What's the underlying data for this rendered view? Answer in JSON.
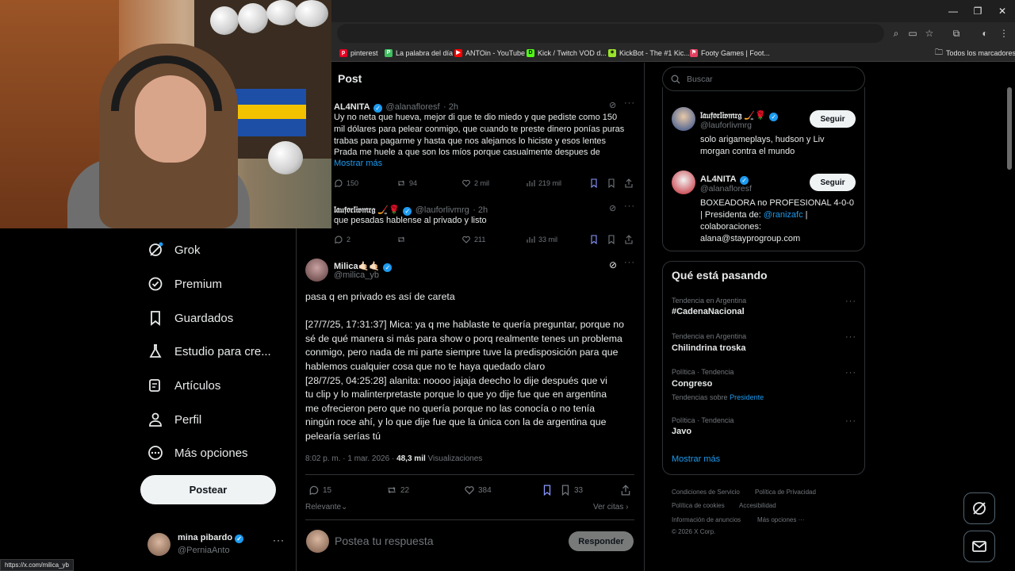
{
  "browser": {
    "bookmarks": [
      {
        "label": "pinterest",
        "color": "#e60023"
      },
      {
        "label": "La palabra del día",
        "color": "#3fbf5f"
      },
      {
        "label": "ANTOin - YouTube",
        "color": "#ff0000"
      },
      {
        "label": "Kick / Twitch VOD d...",
        "color": "#53fc18"
      },
      {
        "label": "KickBot - The #1 Kic...",
        "color": "#9be52a"
      },
      {
        "label": "Footy Games | Foot...",
        "color": "#e4405f"
      }
    ],
    "all_bookmarks": "Todos los marcadores",
    "status_url": "https://x.com/milica_yb"
  },
  "nav": {
    "items": [
      {
        "label": "Grok",
        "icon": "grok-icon"
      },
      {
        "label": "Premium",
        "icon": "premium-icon"
      },
      {
        "label": "Guardados",
        "icon": "bookmark-icon"
      },
      {
        "label": "Estudio para cre...",
        "icon": "studio-icon"
      },
      {
        "label": "Artículos",
        "icon": "articles-icon"
      },
      {
        "label": "Perfil",
        "icon": "profile-icon"
      },
      {
        "label": "Más opciones",
        "icon": "more-icon"
      }
    ],
    "post_button": "Postear",
    "account": {
      "name": "mina pibardo",
      "handle": "@PerniaAnto"
    }
  },
  "header": {
    "title": "Post"
  },
  "context_tweets": [
    {
      "name": "AL4NITA",
      "handle": "@alanafloresf",
      "time": "· 2h",
      "text": "Uy no neta que hueva, mejor di que te dio miedo y que pediste como 150\nmil dólares para pelear conmigo, que cuando te preste dinero ponías puras\ntrabas para pagarme y hasta que nos alejamos lo hiciste y esos lentes\nPrada me huele a que son los míos porque casualmente despues de",
      "show_more": "Mostrar más",
      "replies": "150",
      "reposts": "94",
      "likes": "2 mil",
      "views": "219 mil"
    },
    {
      "name": "𝔩𝔞𝔲𝔣𝔬𝔯𝔩𝔦𝔳𝔪𝔯𝔤 🏒🌹",
      "handle": "@lauforlivmrg",
      "time": "· 2h",
      "text": "que pesadas hablense al privado y listo",
      "replies": "2",
      "reposts": "",
      "likes": "211",
      "views": "33 mil"
    }
  ],
  "main_tweet": {
    "name": "Milica🤙🏻🤙🏻",
    "handle": "@milica_yb",
    "text": "pasa q en privado es así de careta\n\n[27/7/25, 17:31:37] Mica: ya q me hablaste te quería preguntar, porque no\nsé de qué manera si más para show o porq realmente tenes un problema\nconmigo, pero nada de mi parte siempre tuve la predisposición para que\nhablemos cualquier cosa que no te haya quedado claro\n [28/7/25, 04:25:28] alanita: noooo jajaja deecho lo dije después que vi\ntu clip y lo malinterpretaste porque lo que yo dije fue que en argentina\nme ofrecieron pero que no quería porque no las conocía o no tenía\nningún roce ahí, y lo que dije fue que la única con la de argentina que\npelearía serías tú",
    "timestamp": "8:02 p. m. · 1 mar. 2026 ·",
    "views_count": "48,3 mil",
    "views_label": "Visualizaciones",
    "replies": "15",
    "reposts": "22",
    "likes": "384",
    "bookmarks": "33",
    "sort_label": "Relevante",
    "quotes_label": "Ver citas",
    "reply_placeholder": "Postea tu respuesta",
    "reply_button": "Responder"
  },
  "sidebar": {
    "search_placeholder": "Buscar",
    "who_to_follow": [
      {
        "name": "𝔩𝔞𝔲𝔣𝔬𝔯𝔩𝔦𝔳𝔪𝔯𝔤 🏒🌹",
        "handle": "@lauforlivmrg",
        "bio": "solo arigameplays, hudson y Liv\nmorgan contra el mundo",
        "button": "Seguir"
      },
      {
        "name": "AL4NITA",
        "handle": "@alanafloresf",
        "bio_before": "BOXEADORA no PROFESIONAL 4-0-0\n| Presidenta de: ",
        "bio_link": "@ranizafc",
        "bio_after": " |\ncolaboraciones:\nalana@stayprogroup.com",
        "button": "Seguir"
      }
    ],
    "trends_title": "Qué está pasando",
    "trends": [
      {
        "meta": "Tendencia en Argentina",
        "name": "#CadenaNacional",
        "extra": ""
      },
      {
        "meta": "Tendencia en Argentina",
        "name": "Chilindrina troska",
        "extra": ""
      },
      {
        "meta": "Política · Tendencia",
        "name": "Congreso",
        "extra": "Tendencias sobre",
        "extra_link": "Presidente"
      },
      {
        "meta": "Política · Tendencia",
        "name": "Javo",
        "extra": ""
      }
    ],
    "show_more": "Mostrar más",
    "footer": [
      "Condiciones de Servicio",
      "Política de Privacidad",
      "Política de cookies",
      "Accesibilidad",
      "Información de anuncios",
      "Más opciones ···",
      "© 2026 X Corp."
    ]
  },
  "colors": {
    "accent": "#1d9bf0",
    "background": "#000000",
    "border": "#2f3336",
    "muted": "#71767b"
  }
}
